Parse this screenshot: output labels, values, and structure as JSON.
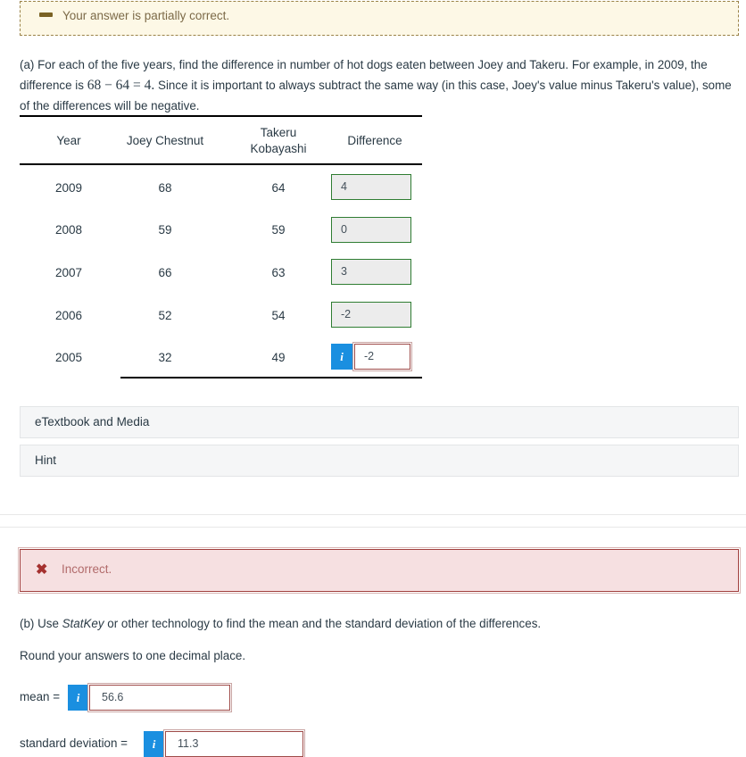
{
  "status_banner": {
    "icon": "minus-dash-icon",
    "text": "Your answer is partially correct."
  },
  "question_a": {
    "prefix": "(a) For each of the five years, find the difference in number of hot dogs eaten between Joey and Takeru. For example, in 2009, the difference is ",
    "math": "68 − 64 = 4.",
    "suffix": " Since it is important to always subtract the same way (in this case, Joey's value minus Takeru's value), some of the differences will be negative."
  },
  "table": {
    "headers": {
      "year": "Year",
      "joey": "Joey Chestnut",
      "takeru_line1": "Takeru",
      "takeru_line2": "Kobayashi",
      "difference": "Difference"
    },
    "rows": [
      {
        "year": "2009",
        "joey": "68",
        "takeru": "64",
        "difference": "4",
        "state": "correct"
      },
      {
        "year": "2008",
        "joey": "59",
        "takeru": "59",
        "difference": "0",
        "state": "correct"
      },
      {
        "year": "2007",
        "joey": "66",
        "takeru": "63",
        "difference": "3",
        "state": "correct"
      },
      {
        "year": "2006",
        "joey": "52",
        "takeru": "54",
        "difference": "-2",
        "state": "correct"
      },
      {
        "year": "2005",
        "joey": "32",
        "takeru": "49",
        "difference": "-2",
        "state": "incorrect"
      }
    ]
  },
  "sections": {
    "etextbook_label": "eTextbook and Media",
    "hint_label": "Hint"
  },
  "incorrect_banner": {
    "icon": "x-mark-icon",
    "text": "Incorrect."
  },
  "question_b": {
    "prefix": "(b) Use ",
    "italic": "StatKey",
    "suffix": " or other technology to find the mean and the standard deviation of the differences.",
    "round_note": "Round your answers to one decimal place."
  },
  "answers": {
    "mean_label": "mean =",
    "mean_value": "56.6",
    "sd_label": "standard deviation =",
    "sd_value": "11.3",
    "info_icon_glyph": "i"
  },
  "colors": {
    "correct_border": "#2f7d32",
    "incorrect_border": "#9e4a48",
    "info_blue": "#1a8fe0",
    "partial_bg": "#fdf8e6",
    "incorrect_bg": "#f6e0e1"
  }
}
